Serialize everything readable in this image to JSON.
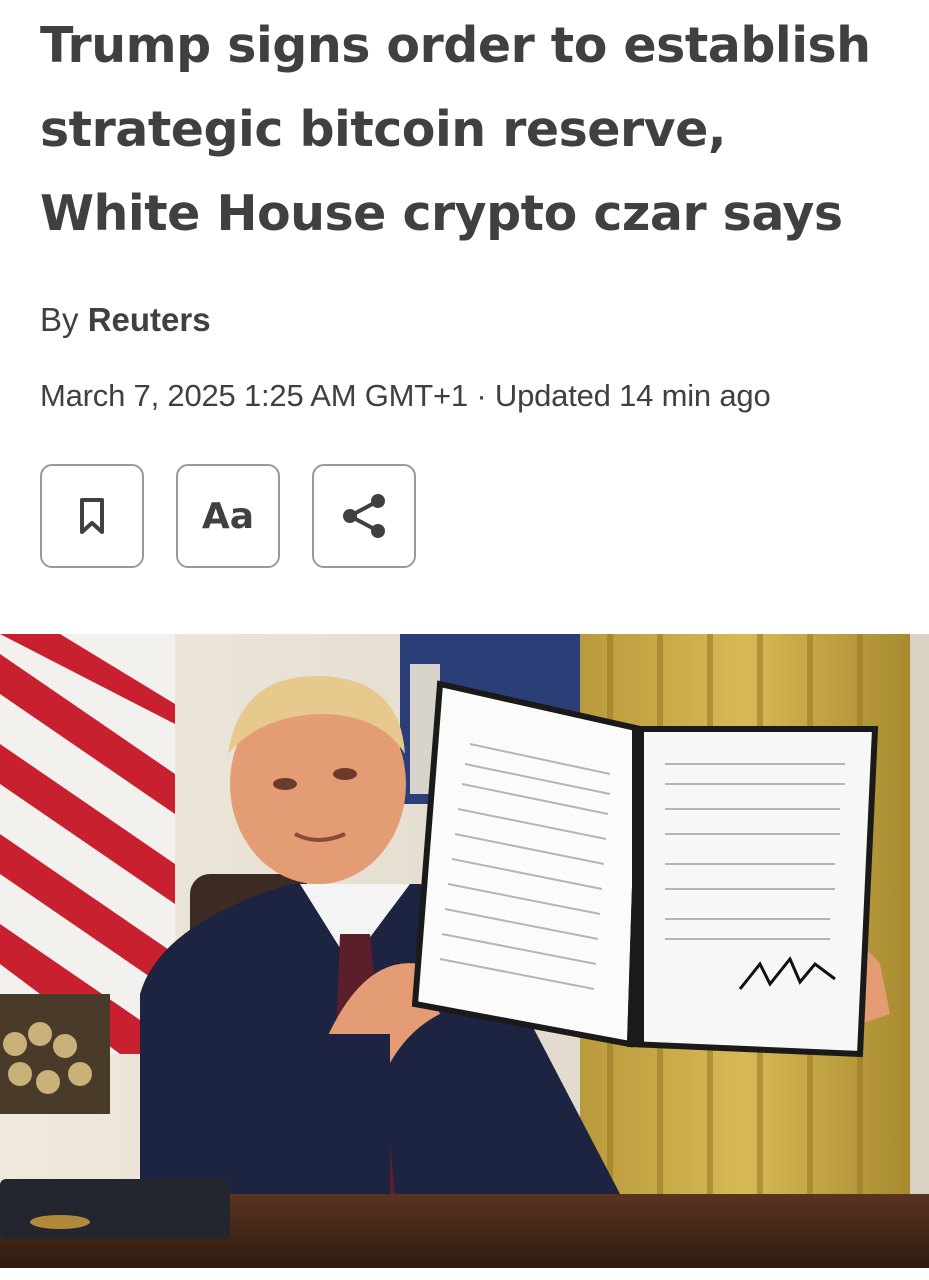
{
  "article": {
    "headline": "Trump signs order to establish strategic bitcoin reserve, White House crypto czar says",
    "byline_prefix": "By ",
    "author": "Reuters",
    "dateline": "March 7, 2025 1:25 AM GMT+1 · Updated 14 min ago"
  },
  "actions": {
    "bookmark_icon": "bookmark-icon",
    "text_size_label": "Aa",
    "share_icon": "share-icon"
  },
  "photo": {
    "subject": "president-holding-signed-executive-order"
  }
}
